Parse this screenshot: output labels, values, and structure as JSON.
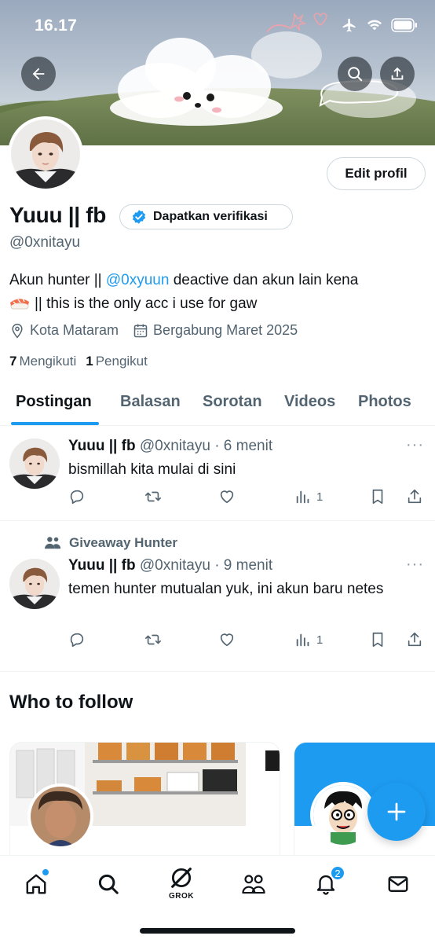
{
  "status_bar": {
    "time": "16.17"
  },
  "profile": {
    "name": "Yuuu || fb",
    "verify_label": "Dapatkan verifikasi",
    "handle": "@0xnitayu",
    "edit_label": "Edit profil",
    "bio_prefix": "Akun hunter || ",
    "bio_mention": "@0xyuun",
    "bio_suffix": " deactive dan akun lain kena",
    "bio_line2": "|| this is the only acc i use for gaw",
    "location": "Kota Mataram",
    "joined": "Bergabung Maret 2025",
    "following_count": "7",
    "following_label": "Mengikuti",
    "followers_count": "1",
    "followers_label": "Pengikut"
  },
  "tabs": [
    {
      "label": "Postingan",
      "active": true
    },
    {
      "label": "Balasan"
    },
    {
      "label": "Sorotan"
    },
    {
      "label": "Videos"
    },
    {
      "label": "Photos"
    }
  ],
  "posts": [
    {
      "name": "Yuuu || fb",
      "handle_time": "@0xnitayu · 6 menit",
      "text": "bismillah kita mulai di sini",
      "views": "1"
    },
    {
      "community": "Giveaway Hunter",
      "name": "Yuuu || fb",
      "handle_time": "@0xnitayu · 9 menit",
      "text": "temen hunter mutualan yuk, ini akun baru netes",
      "views": "1"
    }
  ],
  "who_to_follow": {
    "title": "Who to follow"
  },
  "bottom_nav": {
    "grok_label": "GROK",
    "notifications_badge": "2"
  },
  "colors": {
    "accent": "#1d9bf0",
    "text": "#0f1419",
    "muted": "#536471"
  }
}
